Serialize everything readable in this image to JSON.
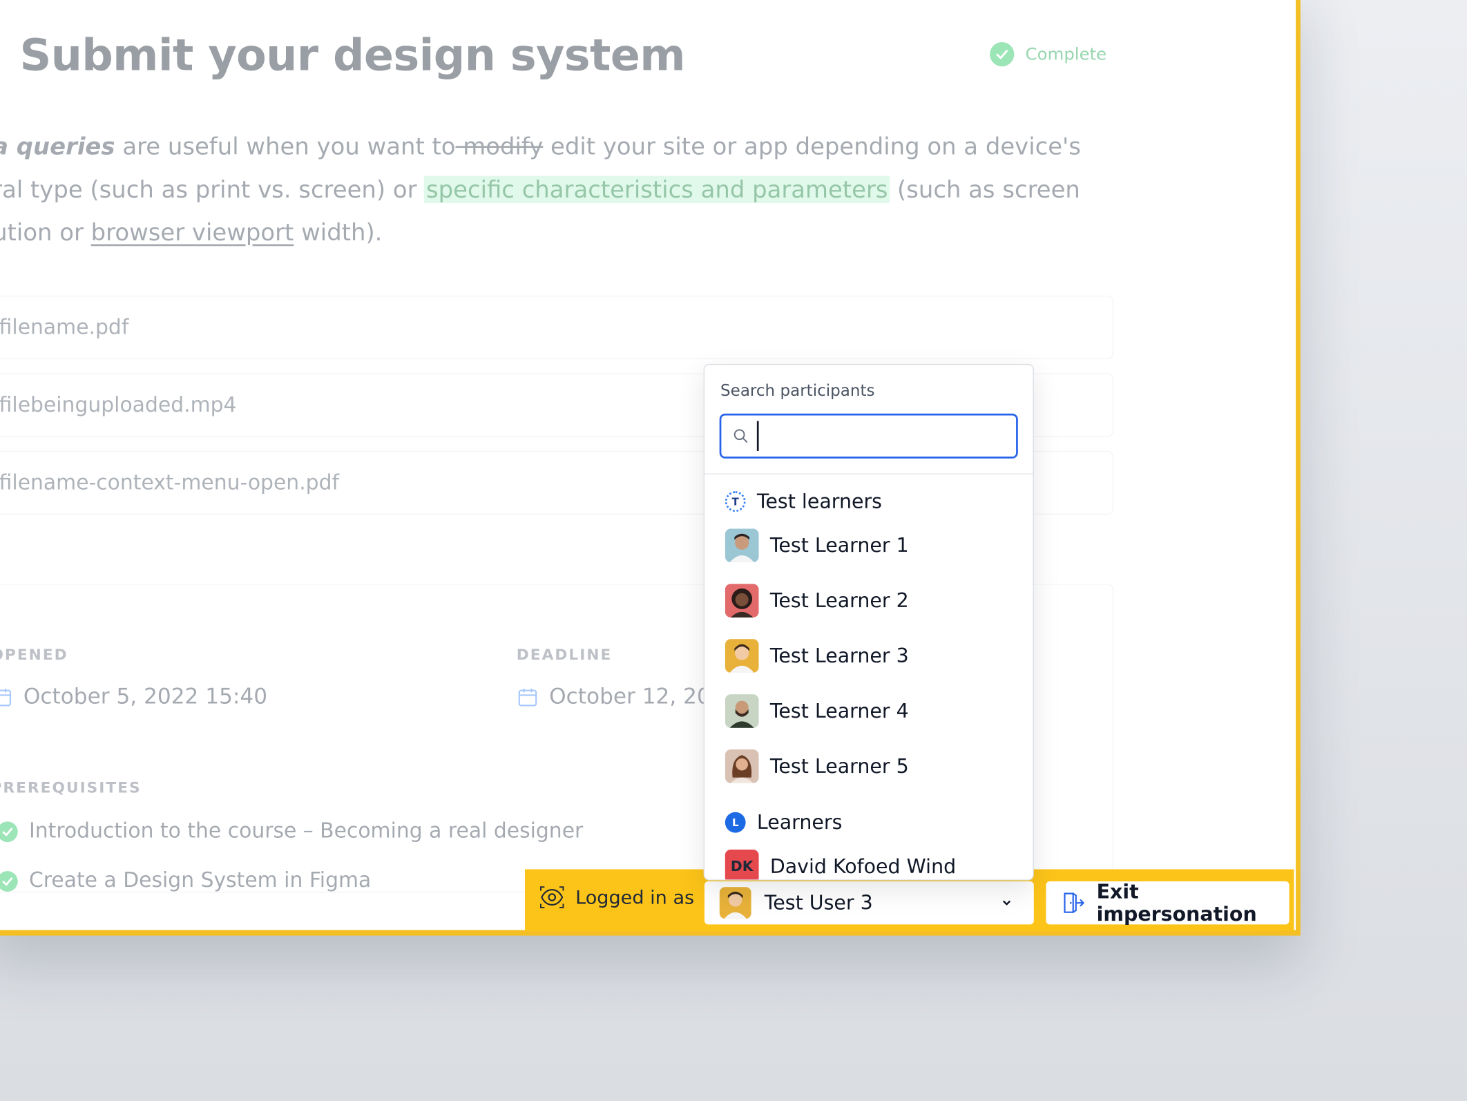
{
  "page": {
    "title": "Submit your design system",
    "status": "Complete",
    "description": {
      "term": "a queries",
      "p1": " are useful when you want to",
      "strike": " modify",
      "p2": " edit your site or app depending on a device's",
      "p3": "ral type (such as print vs. screen) or ",
      "highlight": "specific characteristics and parameters",
      "p4": " (such as screen",
      "p5": "ution or ",
      "link": "browser viewport",
      "p6": " width)."
    },
    "files": [
      "filename.pdf",
      "filebeinguploaded.mp4",
      "filename-context-menu-open.pdf"
    ],
    "opened_label": "OPENED",
    "opened_value": "October 5, 2022 15:40",
    "deadline_label": "DEADLINE",
    "deadline_value": "October 12, 20",
    "prereq_label": "PREREQUISITES",
    "prereqs": [
      "Introduction to the course – Becoming a real designer",
      "Create a Design System in Figma"
    ]
  },
  "impersonation": {
    "logged_in_label": "Logged in as",
    "current_user": "Test User 3",
    "exit_label": "Exit impersonation"
  },
  "dropdown": {
    "search_label": "Search participants",
    "search_value": "",
    "group1_badge": "T",
    "group1_name": "Test learners",
    "people": [
      "Test Learner 1",
      "Test Learner 2",
      "Test Learner 3",
      "Test Learner 4",
      "Test Learner 5"
    ],
    "group2_badge": "L",
    "group2_name": "Learners",
    "learner_initials": "DK",
    "learner_name": "David Kofoed Wind"
  },
  "colors": {
    "accent_yellow": "#fcc419",
    "success_green": "#22c55e",
    "focus_blue": "#2563eb",
    "learner_badge_blue": "#1d6ae5",
    "dk_badge_red": "#e5484d"
  }
}
